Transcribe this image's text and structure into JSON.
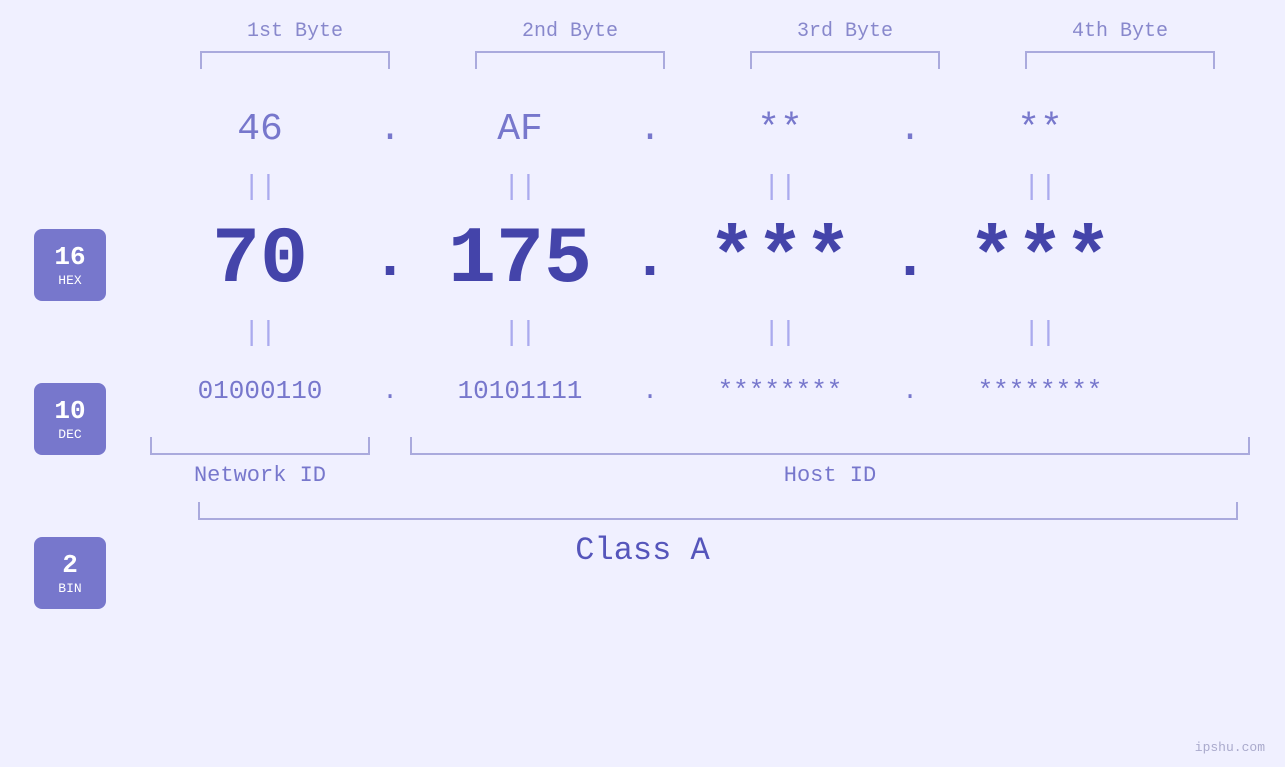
{
  "headers": {
    "byte1": "1st Byte",
    "byte2": "2nd Byte",
    "byte3": "3rd Byte",
    "byte4": "4th Byte"
  },
  "badges": {
    "hex": {
      "number": "16",
      "label": "HEX"
    },
    "dec": {
      "number": "10",
      "label": "DEC"
    },
    "bin": {
      "number": "2",
      "label": "BIN"
    }
  },
  "hex_row": {
    "b1": "46",
    "b2": "AF",
    "b3": "**",
    "b4": "**"
  },
  "dec_row": {
    "b1": "70",
    "b2": "175",
    "b3": "***",
    "b4": "***"
  },
  "bin_row": {
    "b1": "01000110",
    "b2": "10101111",
    "b3": "********",
    "b4": "********"
  },
  "labels": {
    "network_id": "Network ID",
    "host_id": "Host ID",
    "class": "Class A"
  },
  "watermark": "ipshu.com",
  "colors": {
    "light_purple": "#7777cc",
    "dark_purple": "#4444aa",
    "border": "#aaaadd",
    "bg": "#f0f0ff"
  }
}
